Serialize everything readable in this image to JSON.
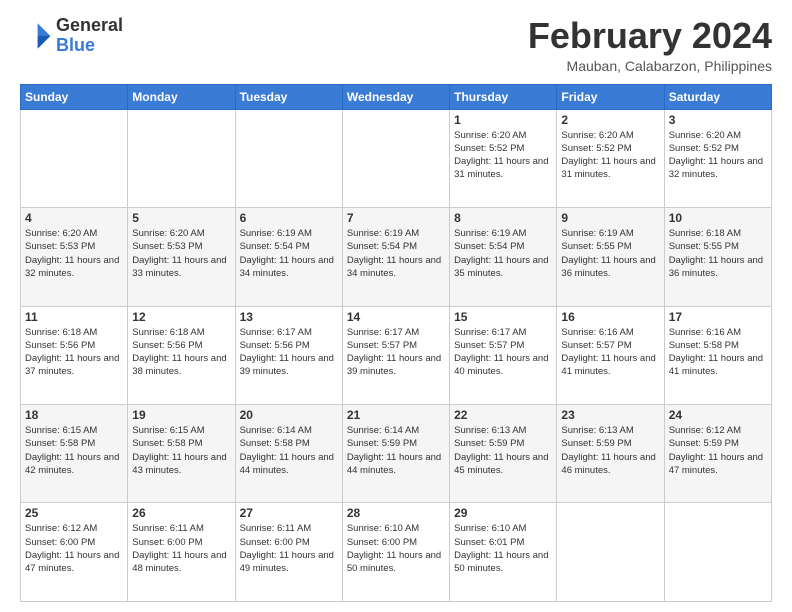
{
  "header": {
    "logo": {
      "line1": "General",
      "line2": "Blue"
    },
    "title": "February 2024",
    "location": "Mauban, Calabarzon, Philippines"
  },
  "days_of_week": [
    "Sunday",
    "Monday",
    "Tuesday",
    "Wednesday",
    "Thursday",
    "Friday",
    "Saturday"
  ],
  "weeks": [
    [
      {
        "day": "",
        "info": ""
      },
      {
        "day": "",
        "info": ""
      },
      {
        "day": "",
        "info": ""
      },
      {
        "day": "",
        "info": ""
      },
      {
        "day": "1",
        "info": "Sunrise: 6:20 AM\nSunset: 5:52 PM\nDaylight: 11 hours and 31 minutes."
      },
      {
        "day": "2",
        "info": "Sunrise: 6:20 AM\nSunset: 5:52 PM\nDaylight: 11 hours and 31 minutes."
      },
      {
        "day": "3",
        "info": "Sunrise: 6:20 AM\nSunset: 5:52 PM\nDaylight: 11 hours and 32 minutes."
      }
    ],
    [
      {
        "day": "4",
        "info": "Sunrise: 6:20 AM\nSunset: 5:53 PM\nDaylight: 11 hours and 32 minutes."
      },
      {
        "day": "5",
        "info": "Sunrise: 6:20 AM\nSunset: 5:53 PM\nDaylight: 11 hours and 33 minutes."
      },
      {
        "day": "6",
        "info": "Sunrise: 6:19 AM\nSunset: 5:54 PM\nDaylight: 11 hours and 34 minutes."
      },
      {
        "day": "7",
        "info": "Sunrise: 6:19 AM\nSunset: 5:54 PM\nDaylight: 11 hours and 34 minutes."
      },
      {
        "day": "8",
        "info": "Sunrise: 6:19 AM\nSunset: 5:54 PM\nDaylight: 11 hours and 35 minutes."
      },
      {
        "day": "9",
        "info": "Sunrise: 6:19 AM\nSunset: 5:55 PM\nDaylight: 11 hours and 36 minutes."
      },
      {
        "day": "10",
        "info": "Sunrise: 6:18 AM\nSunset: 5:55 PM\nDaylight: 11 hours and 36 minutes."
      }
    ],
    [
      {
        "day": "11",
        "info": "Sunrise: 6:18 AM\nSunset: 5:56 PM\nDaylight: 11 hours and 37 minutes."
      },
      {
        "day": "12",
        "info": "Sunrise: 6:18 AM\nSunset: 5:56 PM\nDaylight: 11 hours and 38 minutes."
      },
      {
        "day": "13",
        "info": "Sunrise: 6:17 AM\nSunset: 5:56 PM\nDaylight: 11 hours and 39 minutes."
      },
      {
        "day": "14",
        "info": "Sunrise: 6:17 AM\nSunset: 5:57 PM\nDaylight: 11 hours and 39 minutes."
      },
      {
        "day": "15",
        "info": "Sunrise: 6:17 AM\nSunset: 5:57 PM\nDaylight: 11 hours and 40 minutes."
      },
      {
        "day": "16",
        "info": "Sunrise: 6:16 AM\nSunset: 5:57 PM\nDaylight: 11 hours and 41 minutes."
      },
      {
        "day": "17",
        "info": "Sunrise: 6:16 AM\nSunset: 5:58 PM\nDaylight: 11 hours and 41 minutes."
      }
    ],
    [
      {
        "day": "18",
        "info": "Sunrise: 6:15 AM\nSunset: 5:58 PM\nDaylight: 11 hours and 42 minutes."
      },
      {
        "day": "19",
        "info": "Sunrise: 6:15 AM\nSunset: 5:58 PM\nDaylight: 11 hours and 43 minutes."
      },
      {
        "day": "20",
        "info": "Sunrise: 6:14 AM\nSunset: 5:58 PM\nDaylight: 11 hours and 44 minutes."
      },
      {
        "day": "21",
        "info": "Sunrise: 6:14 AM\nSunset: 5:59 PM\nDaylight: 11 hours and 44 minutes."
      },
      {
        "day": "22",
        "info": "Sunrise: 6:13 AM\nSunset: 5:59 PM\nDaylight: 11 hours and 45 minutes."
      },
      {
        "day": "23",
        "info": "Sunrise: 6:13 AM\nSunset: 5:59 PM\nDaylight: 11 hours and 46 minutes."
      },
      {
        "day": "24",
        "info": "Sunrise: 6:12 AM\nSunset: 5:59 PM\nDaylight: 11 hours and 47 minutes."
      }
    ],
    [
      {
        "day": "25",
        "info": "Sunrise: 6:12 AM\nSunset: 6:00 PM\nDaylight: 11 hours and 47 minutes."
      },
      {
        "day": "26",
        "info": "Sunrise: 6:11 AM\nSunset: 6:00 PM\nDaylight: 11 hours and 48 minutes."
      },
      {
        "day": "27",
        "info": "Sunrise: 6:11 AM\nSunset: 6:00 PM\nDaylight: 11 hours and 49 minutes."
      },
      {
        "day": "28",
        "info": "Sunrise: 6:10 AM\nSunset: 6:00 PM\nDaylight: 11 hours and 50 minutes."
      },
      {
        "day": "29",
        "info": "Sunrise: 6:10 AM\nSunset: 6:01 PM\nDaylight: 11 hours and 50 minutes."
      },
      {
        "day": "",
        "info": ""
      },
      {
        "day": "",
        "info": ""
      }
    ]
  ]
}
